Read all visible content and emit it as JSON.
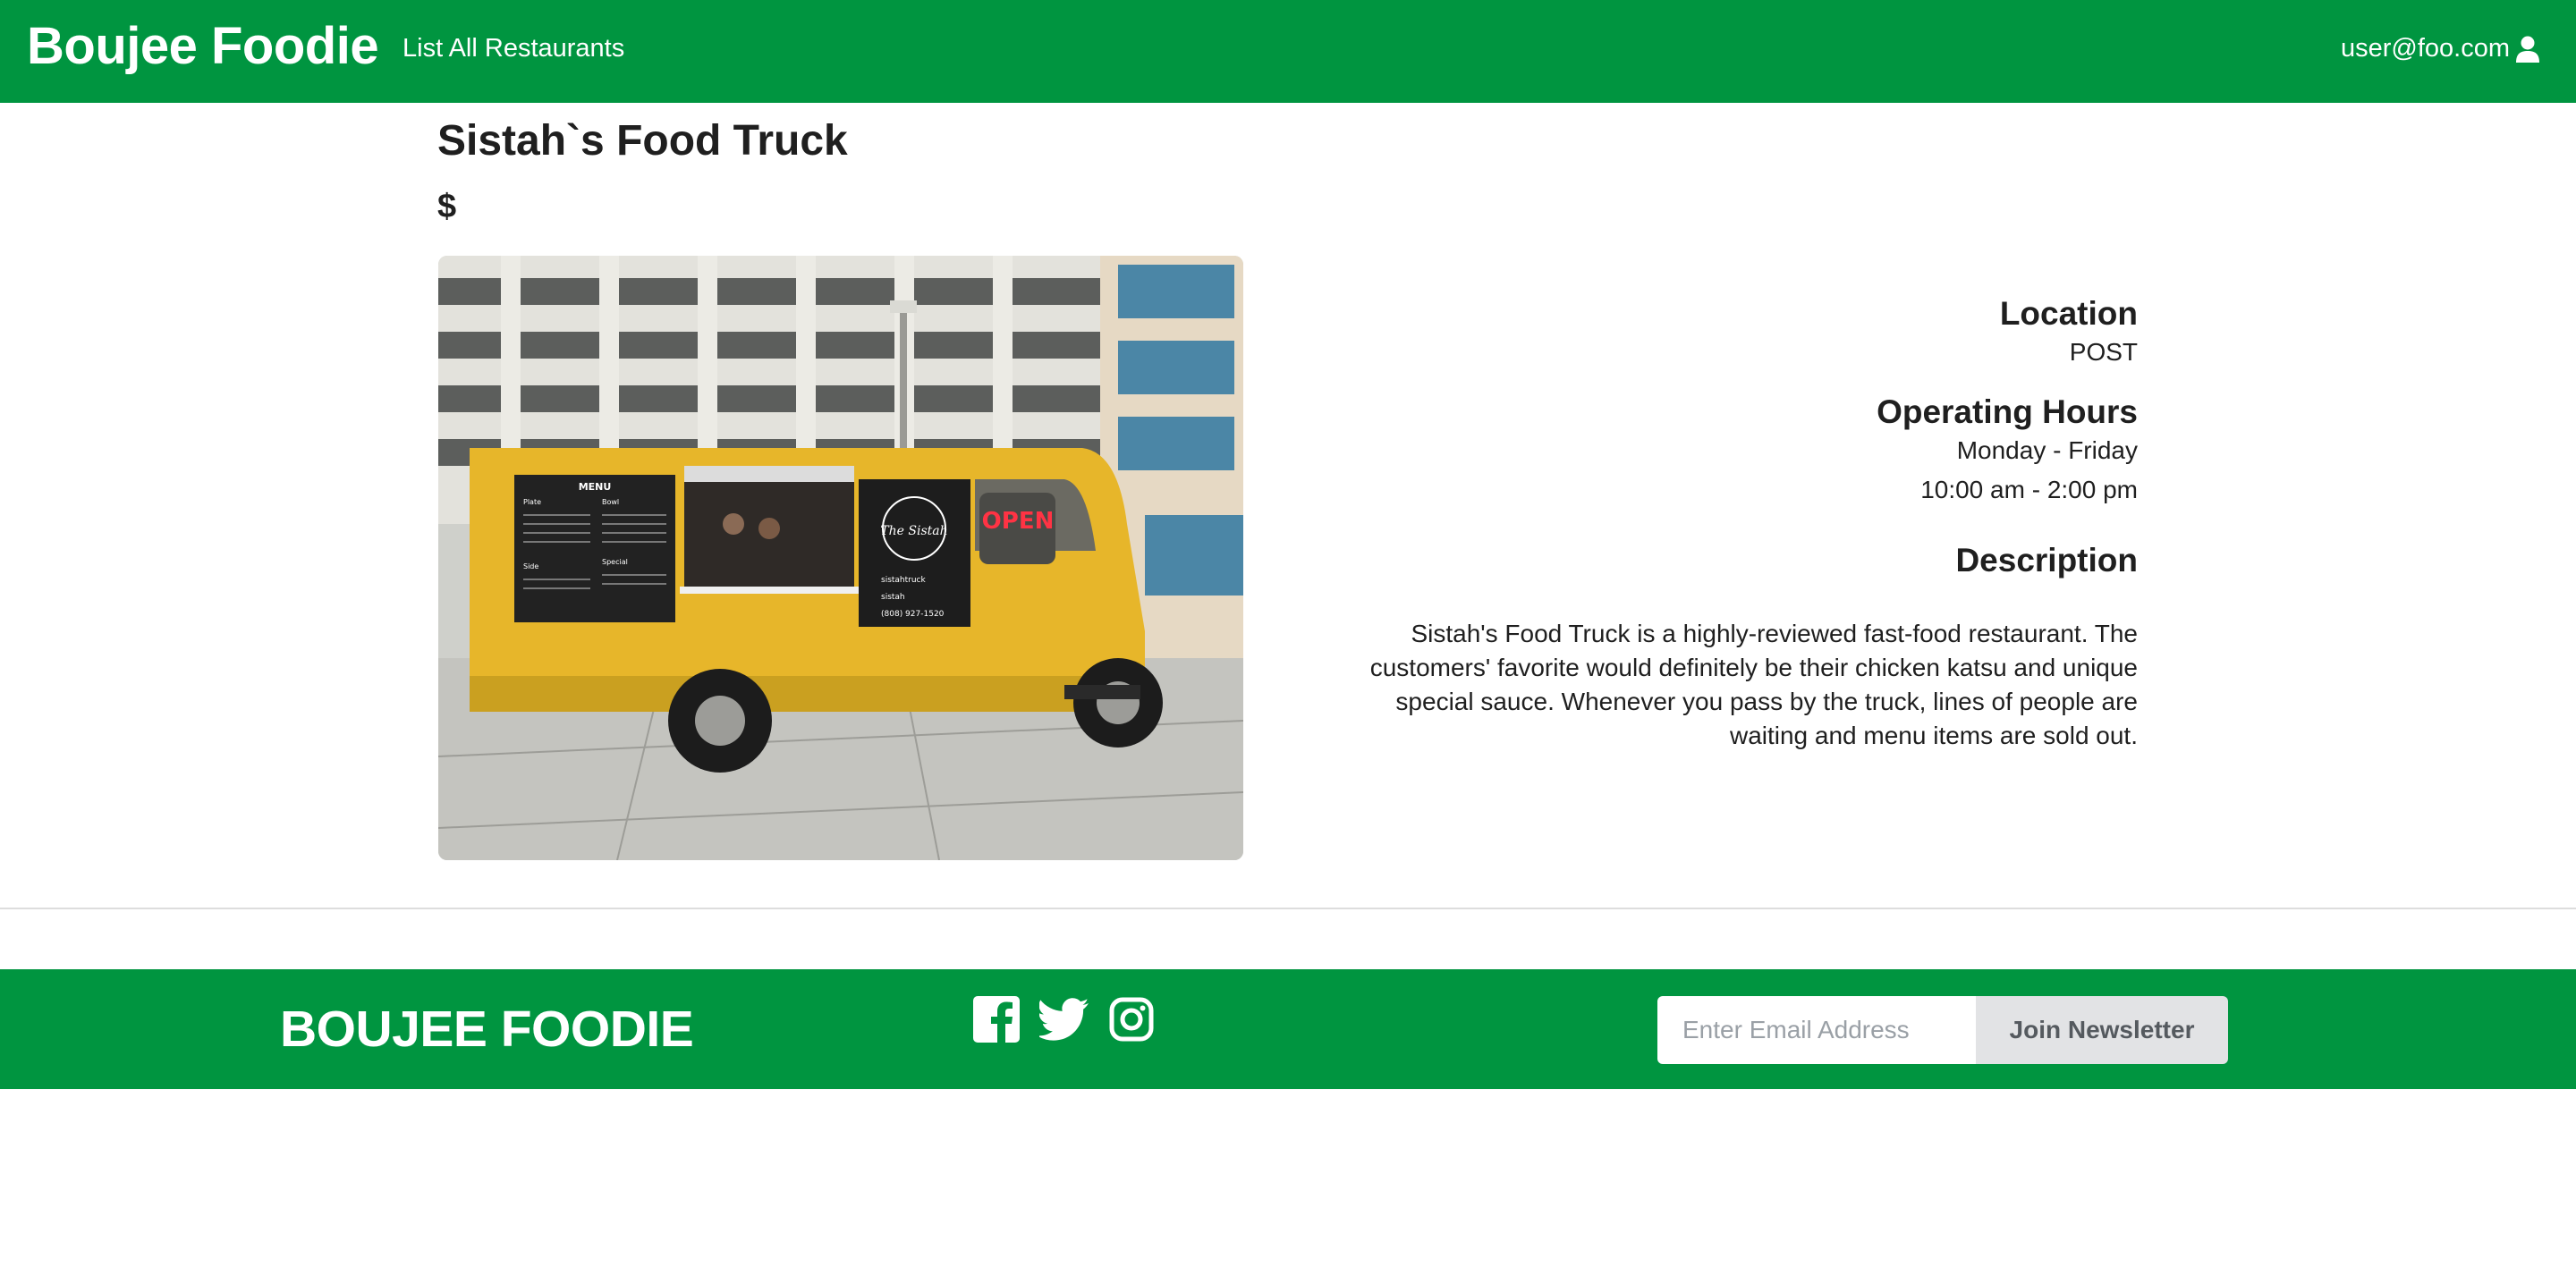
{
  "navbar": {
    "brand": "Boujee Foodie",
    "list_link": "List All Restaurants",
    "user_email": "user@foo.com"
  },
  "restaurant": {
    "name": "Sistah`s Food Truck",
    "price": "$",
    "location_heading": "Location",
    "location": "POST",
    "hours_heading": "Operating Hours",
    "hours_days": "Monday - Friday",
    "hours_time": "10:00 am - 2:00 pm",
    "description_heading": "Description",
    "description": "Sistah's Food Truck is a highly-reviewed fast-food restaurant. The customers' favorite would definitely be their chicken katsu and unique special sauce. Whenever you pass by the truck, lines of people are waiting and menu items are sold out.",
    "photo": {
      "menu_title": "MENU",
      "menu_sections": [
        "Plate",
        "Bowl",
        "Side",
        "Special"
      ],
      "logo_text": "The Sistah",
      "open_sign": "OPEN",
      "handle_instagram": "sistahtruck",
      "handle_yelp": "sistah",
      "phone": "(808) 927-1520"
    }
  },
  "footer": {
    "brand": "BOUJEE FOODIE",
    "social_icons": [
      "facebook-icon",
      "twitter-icon",
      "instagram-icon"
    ],
    "email_placeholder": "Enter Email Address",
    "join_label": "Join Newsletter"
  },
  "colors": {
    "brand_green": "#009540",
    "truck_yellow": "#e7b62a",
    "button_gray": "#e2e3e5"
  }
}
